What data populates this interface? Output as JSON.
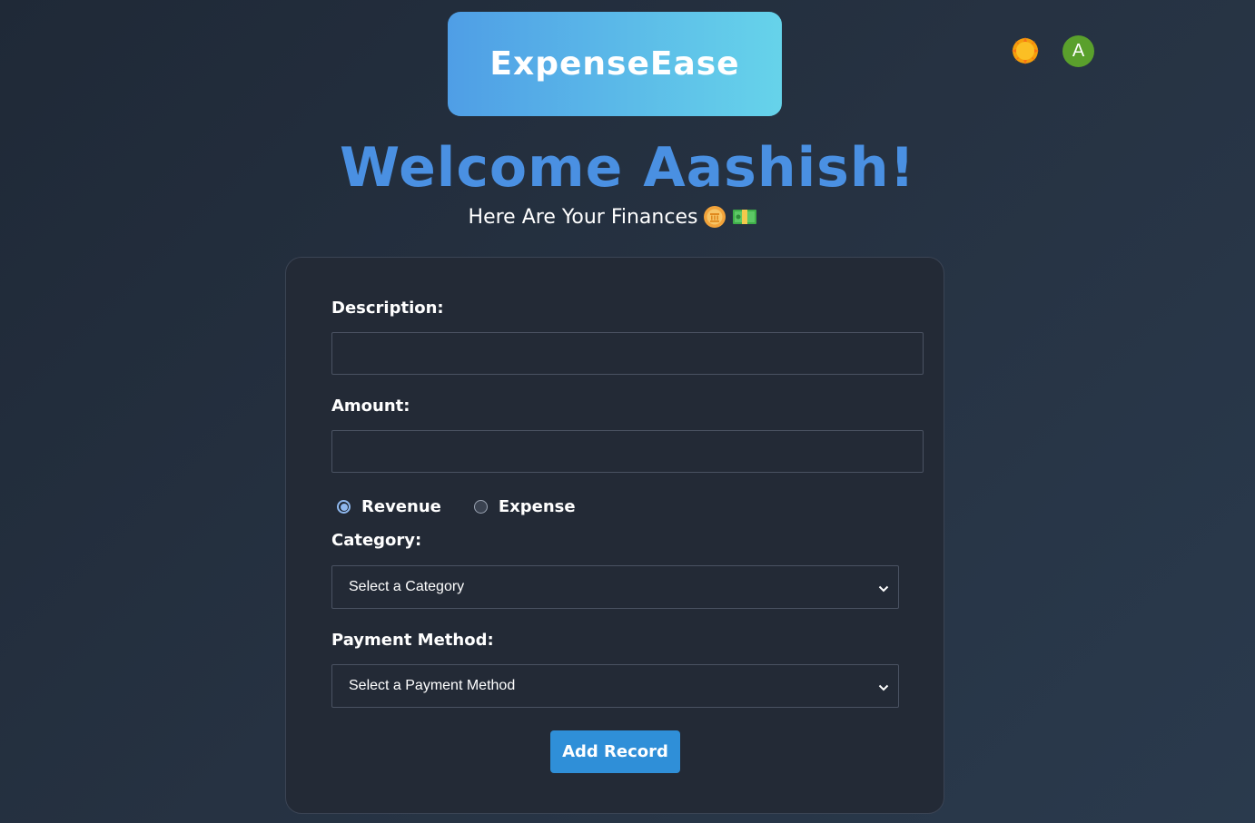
{
  "header": {
    "brand": "ExpenseEase",
    "theme_icon": "sun-icon",
    "avatar_initial": "A"
  },
  "hero": {
    "welcome": "Welcome Aashish!",
    "subtitle": "Here Are Your Finances",
    "subtitle_icons": [
      "coin-icon",
      "money-bill-icon"
    ]
  },
  "form": {
    "description_label": "Description:",
    "description_value": "",
    "amount_label": "Amount:",
    "amount_value": "",
    "type_options": [
      {
        "label": "Revenue",
        "checked": true
      },
      {
        "label": "Expense",
        "checked": false
      }
    ],
    "category_label": "Category:",
    "category_selected": "Select a Category",
    "payment_label": "Payment Method:",
    "payment_selected": "Select a Payment Method",
    "submit_label": "Add Record"
  },
  "colors": {
    "accent": "#4a90e2",
    "button": "#2f8fd8",
    "avatar": "#5aa02c",
    "card_bg": "#232a36"
  }
}
